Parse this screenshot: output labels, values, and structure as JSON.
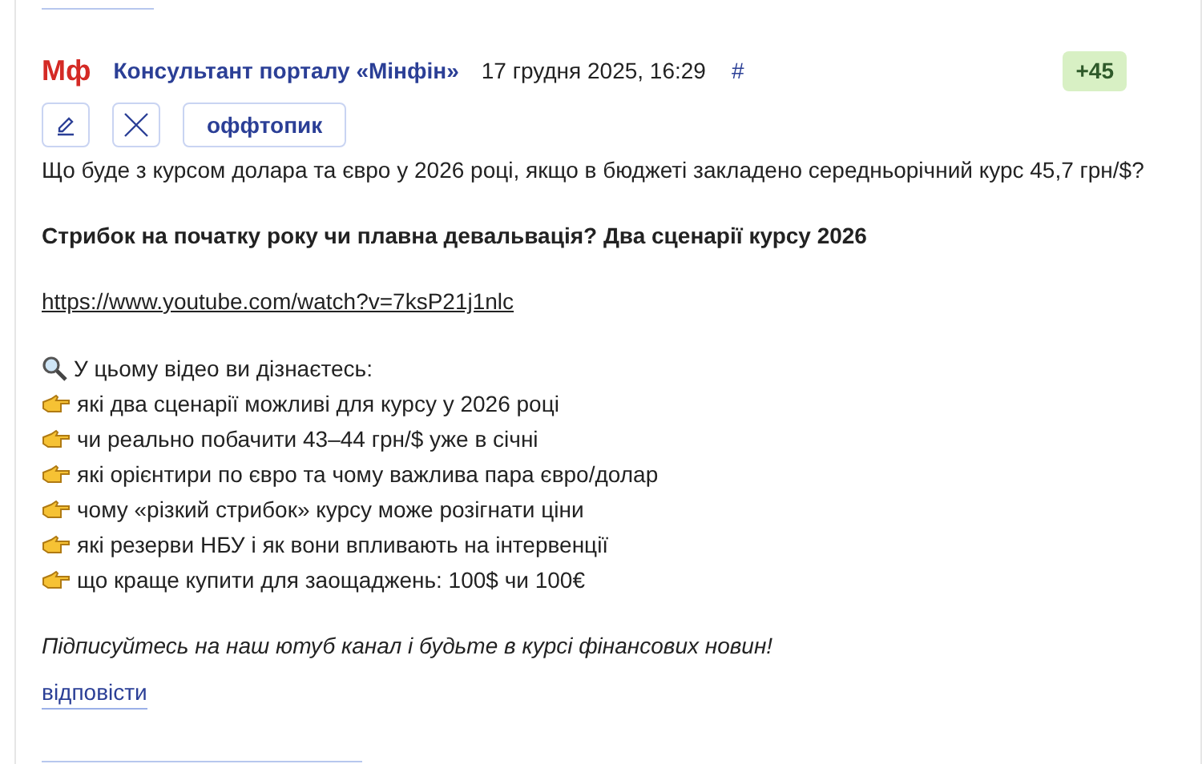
{
  "post": {
    "logo": "Мф",
    "author": "Консультант порталу «Мінфін»",
    "date": "17 грудня 2025, 16:29",
    "anchor": "#",
    "score": "+45",
    "tag": "оффтопик",
    "body": [
      {
        "kind": "text",
        "text": "Що буде з курсом долара та євро у 2026 році, якщо в бюджеті закладено середньорічний курс 45,7 грн/$?"
      },
      {
        "kind": "heading",
        "text": "Стрибок на початку року чи плавна девальвація? Два сценарії курсу 2026"
      },
      {
        "kind": "link",
        "text": "https://www.youtube.com/watch?v=7ksP21j1nlc"
      },
      {
        "kind": "search",
        "text": "У цьому відео ви дізнаєтесь:"
      },
      {
        "kind": "point",
        "text": "які два сценарії можливі для курсу у 2026 році"
      },
      {
        "kind": "point",
        "text": "чи реально побачити 43–44 грн/$ уже в січні"
      },
      {
        "kind": "point",
        "text": "які орієнтири по євро та чому важлива пара євро/долар"
      },
      {
        "kind": "point",
        "text": "чому «різкий стрибок» курсу може розігнати ціни"
      },
      {
        "kind": "point",
        "text": "які резерви НБУ і як вони впливають на інтервенції"
      },
      {
        "kind": "point",
        "text": "що краще купити для заощаджень: 100$ чи 100€"
      },
      {
        "kind": "italic",
        "text": "Підписуйтесь на наш ютуб канал і будьте в курсі фінансових новин!"
      }
    ],
    "reply": "відповісти"
  }
}
